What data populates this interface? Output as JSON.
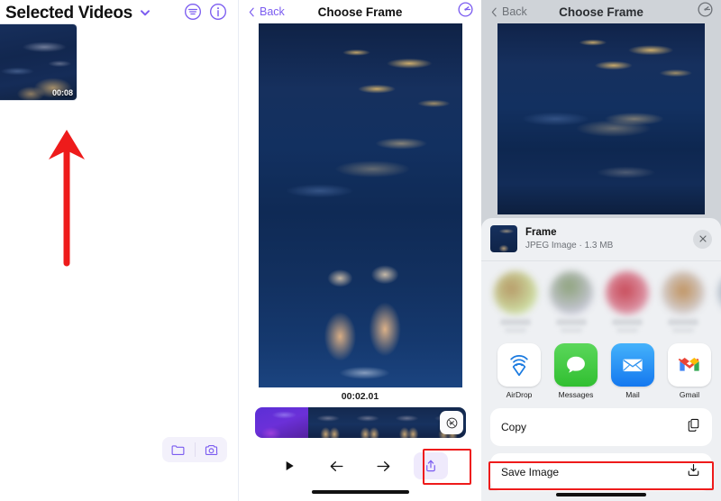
{
  "panel_left": {
    "title": "Selected Videos",
    "chevron_icon": "chevron-down-icon",
    "filter_icon": "filter-icon",
    "info_icon": "info-icon",
    "thumbnail": {
      "duration": "00:08"
    },
    "bottom_actions": [
      {
        "icon": "folder-icon",
        "name": "folder-button"
      },
      {
        "icon": "camera-icon",
        "name": "camera-button"
      }
    ],
    "annotation": {
      "type": "arrow-up",
      "color": "#ee1b1b"
    }
  },
  "panel_mid": {
    "back_label": "Back",
    "title": "Choose Frame",
    "right_icon": "speed-dial-icon",
    "timestamp": "00:02.01",
    "filmstrip_badge_icon": "no-speed-icon",
    "controls": [
      {
        "name": "play-button",
        "icon": "play-icon"
      },
      {
        "name": "prev-frame-button",
        "icon": "arrow-left-icon"
      },
      {
        "name": "next-frame-button",
        "icon": "arrow-right-icon"
      },
      {
        "name": "share-button",
        "icon": "share-icon",
        "highlighted": true
      }
    ]
  },
  "panel_right": {
    "back_label": "Back",
    "title": "Choose Frame",
    "right_icon": "speed-dial-icon",
    "share_sheet": {
      "file_name": "Frame",
      "file_meta": "JPEG Image · 1.3 MB",
      "close_icon": "close-icon",
      "contacts": [
        {
          "name": "contact-1",
          "color1": "#b79a68",
          "color2": "#cfe3a8"
        },
        {
          "name": "contact-2",
          "color1": "#8ea37c",
          "color2": "#c8c8d8"
        },
        {
          "name": "contact-3",
          "color1": "#c84a58",
          "color2": "#e0a2b4"
        },
        {
          "name": "contact-4",
          "color1": "#c0925e",
          "color2": "#d6d6de"
        },
        {
          "name": "contact-5",
          "color1": "#9aa6b4",
          "color2": "#cfd6de"
        }
      ],
      "apps": [
        {
          "label": "AirDrop",
          "icon": "airdrop-icon"
        },
        {
          "label": "Messages",
          "icon": "messages-icon"
        },
        {
          "label": "Mail",
          "icon": "mail-icon"
        },
        {
          "label": "Gmail",
          "icon": "gmail-icon"
        },
        {
          "label": "",
          "icon": "more-app-icon"
        }
      ],
      "actions": [
        {
          "label": "Copy",
          "icon": "copy-icon",
          "highlighted": false
        },
        {
          "label": "Save Image",
          "icon": "save-image-icon",
          "highlighted": true
        }
      ]
    }
  },
  "colors": {
    "accent_purple": "#7b5cf0",
    "highlight_red": "#ee1b1b",
    "sheet_bg": "#eef0f3"
  }
}
